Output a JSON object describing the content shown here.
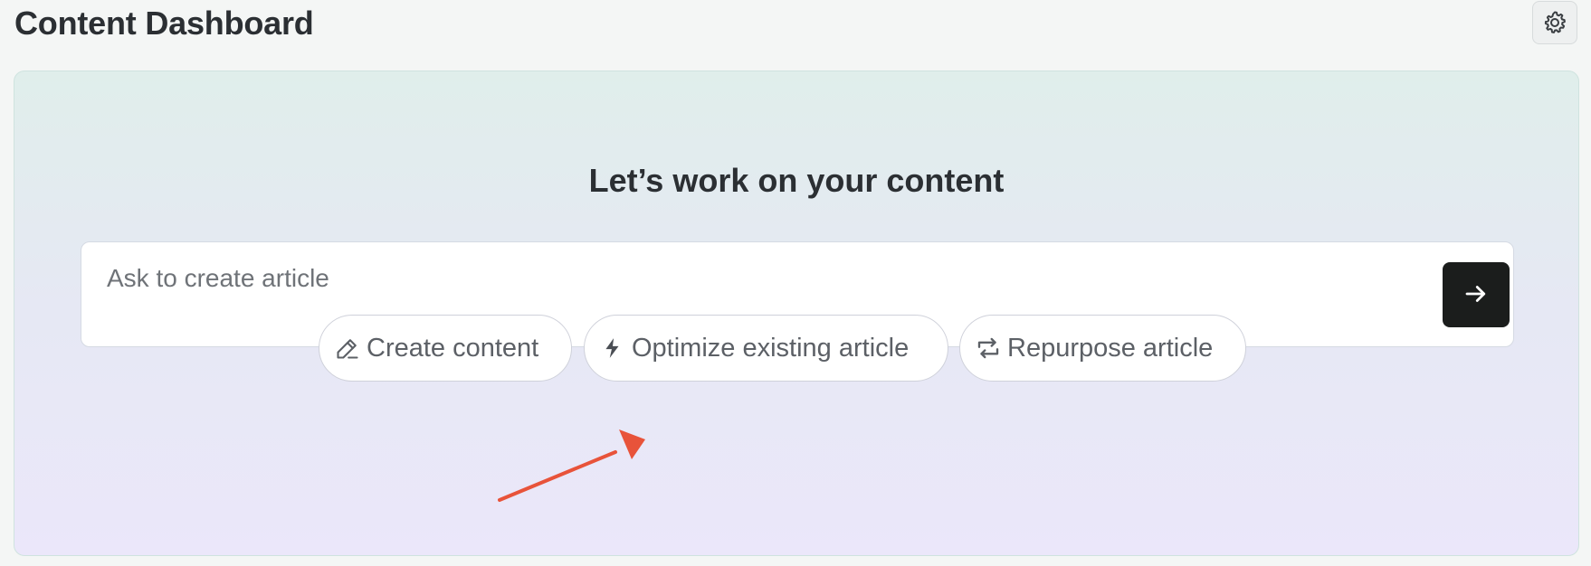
{
  "header": {
    "title": "Content Dashboard",
    "settings_icon": "gear-icon"
  },
  "hero": {
    "heading": "Let’s work on your content",
    "prompt": {
      "placeholder": "Ask to create article",
      "value": "",
      "send_icon": "arrow-right-icon"
    },
    "actions": [
      {
        "label": "Create content",
        "icon": "pencil-icon"
      },
      {
        "label": "Optimize existing article",
        "icon": "lightning-icon"
      },
      {
        "label": "Repurpose article",
        "icon": "repeat-icon"
      }
    ]
  },
  "annotation": {
    "color": "#e8533a"
  },
  "colors": {
    "background": "#f4f6f5",
    "send_button": "#1b1d1c",
    "gradient_top": "#e0eeeb",
    "gradient_bottom": "#ebe7fa"
  }
}
